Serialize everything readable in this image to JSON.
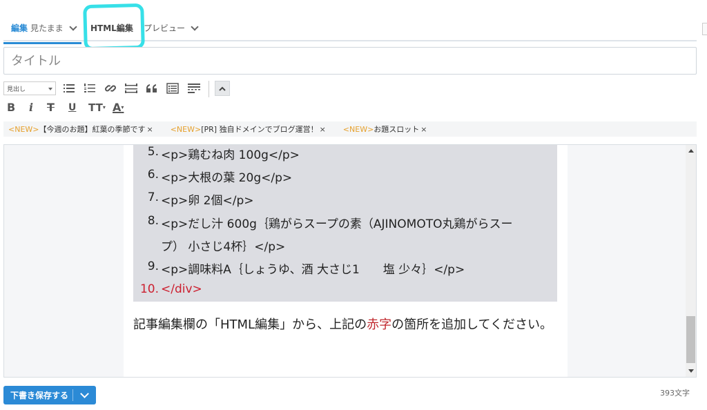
{
  "tabs": {
    "edit_label": "編集",
    "edit_mode": "見たまま",
    "html_label": "HTML編集",
    "preview_label": "プレビュー"
  },
  "title": {
    "placeholder": "タイトル"
  },
  "toolbar": {
    "heading_select": "見出し",
    "format_bold": "B",
    "format_italic": "i",
    "format_strike": "T",
    "format_underline": "U",
    "format_size": "T",
    "format_size_small": "T",
    "format_color": "A"
  },
  "notices": [
    {
      "tag": "<NEW>",
      "text": "【今週のお題】紅葉の季節です",
      "close": "×"
    },
    {
      "tag": "<NEW>",
      "text": "[PR] 独自ドメインでブログ運営！",
      "close": "×"
    },
    {
      "tag": "<NEW>",
      "text": "お題スロット",
      "close": "×"
    }
  ],
  "code_lines": [
    {
      "num": "5.",
      "text": "<p>鶏むね肉 100g</p>"
    },
    {
      "num": "6.",
      "text": "<p>大根の葉 20g</p>"
    },
    {
      "num": "7.",
      "text": "<p>卵 2個</p>"
    },
    {
      "num": "8.",
      "text": "<p>だし汁 600g｛鶏がらスープの素（AJINOMOTO丸鶏がらスー"
    },
    {
      "num": "",
      "text": "プ） 小さじ4杯｝</p>"
    },
    {
      "num": "9.",
      "text": "<p>調味料A｛しょうゆ、酒 大さじ1　　塩 少々｝</p>"
    },
    {
      "num": "10.",
      "text": "</div>"
    }
  ],
  "body": {
    "before": "記事編集欄の「HTML編集」から、上記の",
    "red_word": "赤字",
    "after": "の箇所を追加してください。"
  },
  "footer": {
    "save_label": "下書き保存する",
    "char_count": "393文字"
  },
  "colors": {
    "accent": "#2b8ad6",
    "highlight_marker": "#37e0e8",
    "new_tag": "#e6a12e",
    "red_code": "#cc1f2f"
  }
}
